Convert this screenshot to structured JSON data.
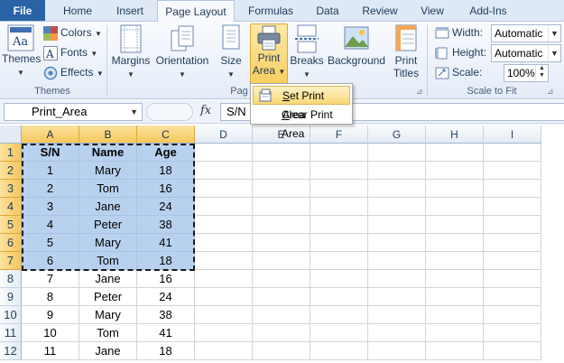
{
  "tabs": {
    "file": "File",
    "home": "Home",
    "insert": "Insert",
    "page_layout": "Page Layout",
    "formulas": "Formulas",
    "data": "Data",
    "review": "Review",
    "view": "View",
    "addins": "Add-Ins"
  },
  "ribbon": {
    "themes_group": {
      "themes": "Themes",
      "colors": "Colors",
      "fonts": "Fonts",
      "effects": "Effects",
      "label": "Themes"
    },
    "page_setup_group": {
      "margins": "Margins",
      "orientation": "Orientation",
      "size": "Size",
      "print_area_1": "Print",
      "print_area_2": "Area",
      "breaks": "Breaks",
      "background": "Background",
      "print_titles_1": "Print",
      "print_titles_2": "Titles",
      "label": "Pag"
    },
    "scale_group": {
      "width_label": "Width:",
      "width_value": "Automatic",
      "height_label": "Height:",
      "height_value": "Automatic",
      "scale_label": "Scale:",
      "scale_value": "100%",
      "label": "Scale to Fit"
    }
  },
  "dropdown": {
    "set_print_area": "Set Print Area",
    "clear_print_area": "Clear Print Area"
  },
  "formula_bar": {
    "name_box": "Print_Area",
    "fx": "fx",
    "content": "S/N"
  },
  "columns": [
    "A",
    "B",
    "C",
    "D",
    "E",
    "F",
    "G",
    "H",
    "I"
  ],
  "rows": [
    "1",
    "2",
    "3",
    "4",
    "5",
    "6",
    "7",
    "8",
    "9",
    "10",
    "11",
    "12"
  ],
  "table": [
    [
      "S/N",
      "Name",
      "Age"
    ],
    [
      "1",
      "Mary",
      "18"
    ],
    [
      "2",
      "Tom",
      "16"
    ],
    [
      "3",
      "Jane",
      "24"
    ],
    [
      "4",
      "Peter",
      "38"
    ],
    [
      "5",
      "Mary",
      "41"
    ],
    [
      "6",
      "Tom",
      "18"
    ],
    [
      "7",
      "Jane",
      "16"
    ],
    [
      "8",
      "Peter",
      "24"
    ],
    [
      "9",
      "Mary",
      "38"
    ],
    [
      "10",
      "Tom",
      "41"
    ],
    [
      "11",
      "Jane",
      "18"
    ]
  ],
  "selection": {
    "rows": 7,
    "cols": 3
  },
  "icons": {
    "themes": "themes-icon",
    "colors": "colors-icon",
    "fonts": "fonts-icon",
    "effects": "effects-icon",
    "margins": "margins-icon",
    "orientation": "orientation-icon",
    "size": "size-icon",
    "print_area": "printer-icon",
    "breaks": "breaks-icon",
    "background": "background-icon",
    "print_titles": "print-titles-icon",
    "width": "width-icon",
    "height": "height-icon",
    "scale": "scale-icon",
    "set_print_area": "set-print-area-icon"
  },
  "colors": {
    "file_tab": "#2a62a6",
    "selection_fill": "#b8d1ee",
    "header_highlight": "#f6c75b"
  }
}
